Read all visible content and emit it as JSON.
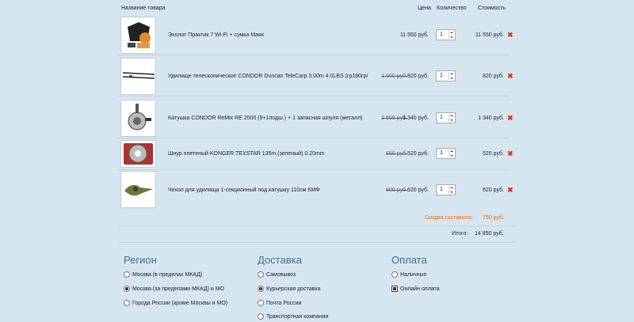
{
  "headers": {
    "name": "Название товара",
    "price": "Цена",
    "qty": "Количество",
    "total": "Стоимость"
  },
  "items": [
    {
      "name": "Эхолот Практик 7 Wi-Fi + сумка Маяк",
      "old_price": "",
      "price": "11 550 руб.",
      "qty": "1",
      "total": "11 550 руб.",
      "thumb_icon": "fish-finder-bag-icon"
    },
    {
      "name": "Удилище телескопическое CONDOR Duncan TeleCarp 3.00m 4.0LBS (гр180гр/",
      "old_price": "1 000 руб.",
      "price": "820 руб.",
      "qty": "1",
      "total": "820 руб.",
      "thumb_icon": "fishing-rod-icon"
    },
    {
      "name": "Катушка CONDOR ReMix RE 2000 (9+1подш.) + 1 запасная шпуля (металл)",
      "old_price": "1 600 руб.",
      "price": "1 340 руб.",
      "qty": "1",
      "total": "1 340 руб.",
      "thumb_icon": "fishing-reel-icon"
    },
    {
      "name": "Шнур плетеный KONGER TEXSTAR 135m.(зеленый) 0.20mm",
      "old_price": "650 руб.",
      "price": "520 руб.",
      "qty": "1",
      "total": "520 руб.",
      "thumb_icon": "braided-line-spool-icon"
    },
    {
      "name": "Чехол для удилища 1-секционный под катушку 110см КМФ",
      "old_price": "800 руб.",
      "price": "620 руб.",
      "qty": "1",
      "total": "620 руб.",
      "thumb_icon": "rod-case-icon"
    }
  ],
  "discount": {
    "label": "Скидка составила:",
    "value": "750 руб."
  },
  "summary": {
    "label": "Итого:",
    "value": "14 850 руб."
  },
  "region": {
    "title": "Регион",
    "options": [
      "Москва (в пределах МКАД)",
      "Москва (за пределами МКАД) и МО",
      "Города России (кроме Москвы и МО)"
    ],
    "selected": 1
  },
  "delivery": {
    "title": "Доставка",
    "options": [
      "Самовывоз",
      "Курьерская доставка",
      "Почта России",
      "Транспортная компания"
    ],
    "selected": 1
  },
  "payment": {
    "title": "Оплата",
    "options": [
      "Наличные",
      "Онлайн оплата"
    ],
    "selected": 1
  },
  "colors": {
    "accent": "#f06a00",
    "delete": "#d9391f",
    "heading": "#4a6b86",
    "background": "#d6e6f0"
  }
}
